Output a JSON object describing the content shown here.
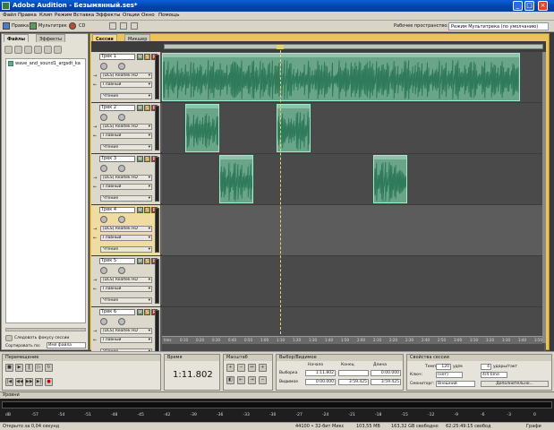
{
  "window": {
    "title": "Adobe Audition - Безымянный.ses*",
    "minimize": "_",
    "maximize": "□",
    "close": "×"
  },
  "menu": [
    "Файл",
    "Правка",
    "Клип",
    "Режим",
    "Вставка",
    "Эффекты",
    "Опции",
    "Окно",
    "Помощь"
  ],
  "toolbar": {
    "edit_label": "Правка",
    "multitrack_label": "Мультитрек",
    "cd_label": "CD",
    "workspace_label": "Рабочее пространство:",
    "workspace_value": "Режим Мультитрека (по умолчанию)"
  },
  "left_panel": {
    "tabs": [
      "Файлы",
      "Эффекты"
    ],
    "file_name": "wave_and_sound1_argsdt_ka",
    "follow_session": "Следовать фокусу сессии",
    "sort_label": "Сортировать по:",
    "sort_value": "Имя файла"
  },
  "main": {
    "tabs": [
      "Сессия",
      "Микшер"
    ]
  },
  "tracks": [
    {
      "name": "Трек 1",
      "input": "[DLS] Realtek HD",
      "output": "Главный",
      "mode": "Чтение"
    },
    {
      "name": "Трек 2",
      "input": "[DLS] Realtek HD",
      "output": "Главный",
      "mode": "Чтение"
    },
    {
      "name": "Трек 3",
      "input": "[DLS] Realtek HD",
      "output": "Главный",
      "mode": "Чтение"
    },
    {
      "name": "Трек 4",
      "input": "[DLS] Realtek HD",
      "output": "Главный",
      "mode": "Чтение"
    },
    {
      "name": "Трек 5",
      "input": "[DLS] Realtek HD",
      "output": "Главный",
      "mode": "Чтение"
    },
    {
      "name": "Трек 6",
      "input": "[DLS] Realtek HD",
      "output": "Главный",
      "mode": "Чтение"
    }
  ],
  "track_buttons": {
    "mute": "M",
    "solo": "S",
    "record": "R"
  },
  "ruler_ticks": [
    "hms",
    "0:10",
    "0:20",
    "0:30",
    "0:40",
    "0:50",
    "1:00",
    "1:10",
    "1:20",
    "1:30",
    "1:40",
    "1:50",
    "2:00",
    "2:10",
    "2:20",
    "2:30",
    "2:40",
    "2:50",
    "3:00",
    "3:10",
    "3:20",
    "3:30",
    "3:40",
    "3:50"
  ],
  "transport": {
    "title": "Перемещение"
  },
  "time": {
    "title": "Время",
    "value": "1:11.802"
  },
  "zoom": {
    "title": "Масштаб"
  },
  "selection": {
    "title": "Выбор/Видимое",
    "col_start": "Начало",
    "col_end": "Конец",
    "col_length": "Длина",
    "row_selection": "Выборка",
    "row_view": "Видимое",
    "sel_start": "1:11.802",
    "sel_end": "",
    "sel_length": "0:00.000",
    "view_start": "0:00.000",
    "view_end": "3:59.425",
    "view_length": "3:59.425"
  },
  "session_props": {
    "title": "Свойства сессии",
    "tempo_label": "Темп",
    "tempo_value": "120",
    "bpm_unit": "уд/м",
    "beats_value": "4",
    "beats_unit": "удары/такт",
    "key_label": "Ключ:",
    "key_value": "(нет)",
    "time_sig_value": "4/4 time",
    "monitor_label": "Смониторг:",
    "monitor_value": "Внешний",
    "advanced_label": "Дополнительно..."
  },
  "levels": {
    "title": "Уровни",
    "scale": [
      "dB",
      "-57",
      "-54",
      "-51",
      "-48",
      "-45",
      "-42",
      "-39",
      "-36",
      "-33",
      "-30",
      "-27",
      "-24",
      "-21",
      "-18",
      "-15",
      "-12",
      "-9",
      "-6",
      "-3",
      "0"
    ]
  },
  "status": {
    "left": "Открыто за 0,04 секунд",
    "rate": "44100 • 32-бит Микс",
    "size": "103,55 MB",
    "free": "163,32 GB свободно",
    "time_free": "62:25:49:15 свобод",
    "view": "Графи"
  }
}
